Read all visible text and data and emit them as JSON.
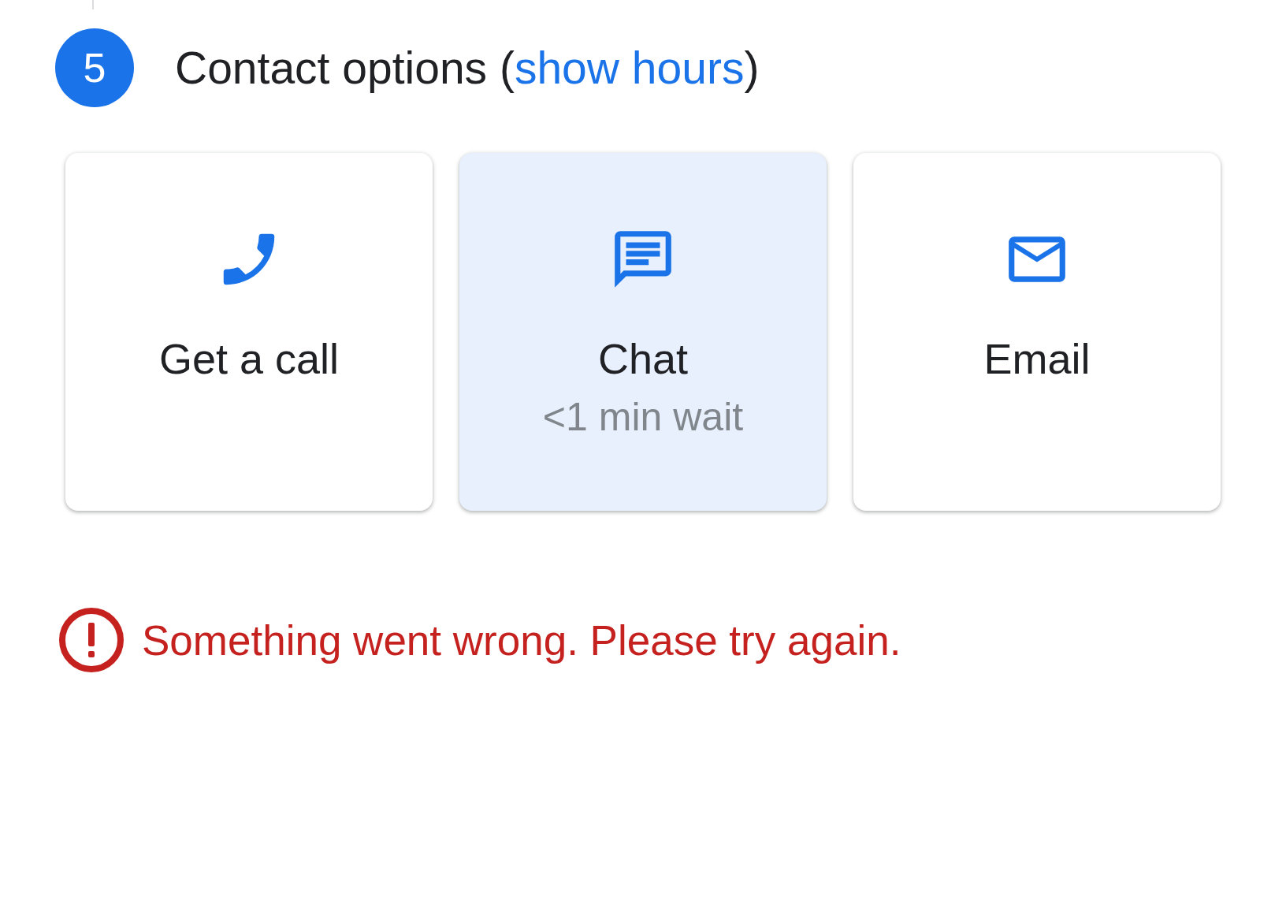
{
  "step": {
    "number": "5",
    "title": "Contact options",
    "paren_open": "(",
    "link": "show hours",
    "paren_close": ")"
  },
  "options": [
    {
      "kind": "phone",
      "label": "Get a call",
      "selected": false
    },
    {
      "kind": "chat",
      "label": "Chat",
      "sublabel": "<1 min wait",
      "selected": true
    },
    {
      "kind": "email",
      "label": "Email",
      "selected": false
    }
  ],
  "error": {
    "message": "Something went wrong. Please try again."
  }
}
